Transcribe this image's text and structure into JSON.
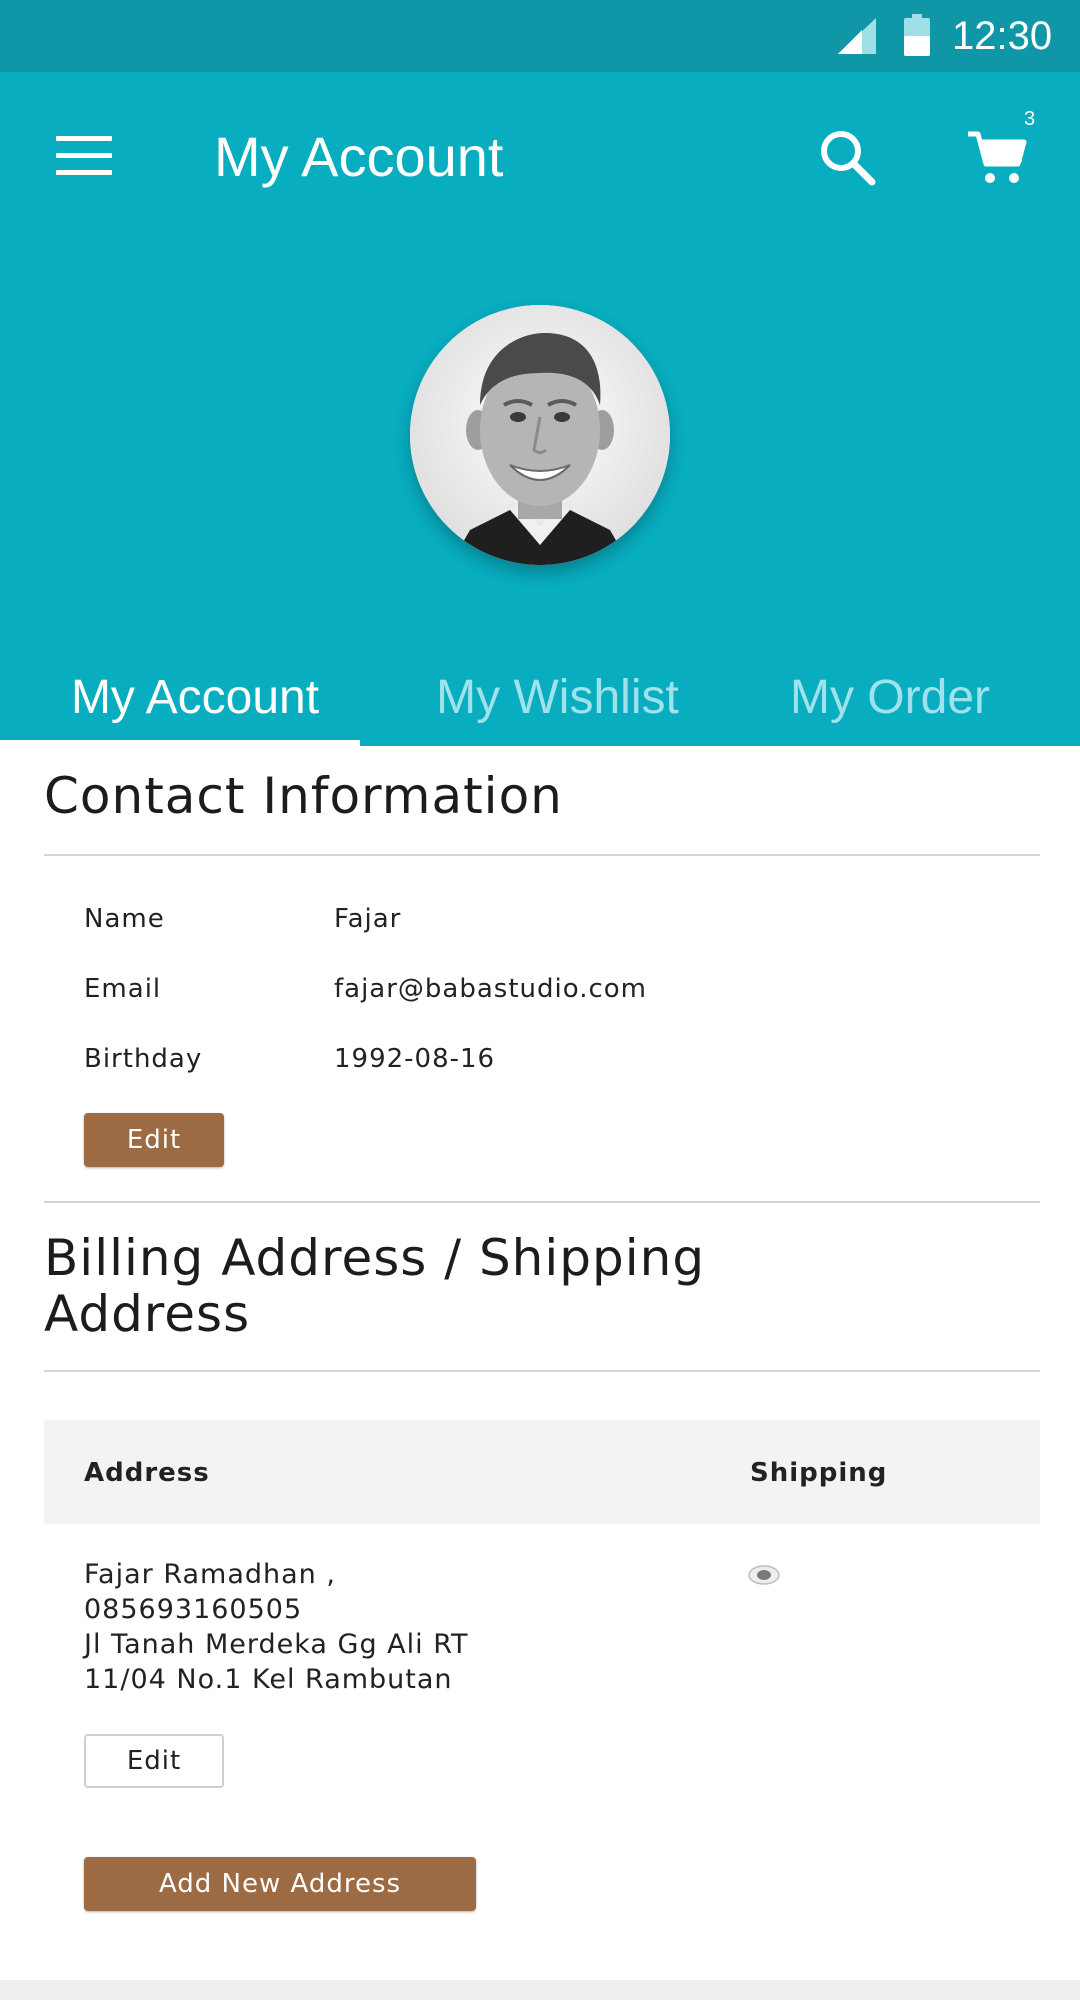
{
  "status_bar": {
    "time": "12:30"
  },
  "app_bar": {
    "title": "My Account",
    "cart_count": "3"
  },
  "tabs": [
    {
      "label": "My Account",
      "active": true
    },
    {
      "label": "My Wishlist",
      "active": false
    },
    {
      "label": "My Order",
      "active": false
    }
  ],
  "contact": {
    "title": "Contact Information",
    "fields": [
      {
        "label": "Name",
        "value": "Fajar"
      },
      {
        "label": "Email",
        "value": "fajar@babastudio.com"
      },
      {
        "label": "Birthday",
        "value": "1992-08-16"
      }
    ],
    "edit_label": "Edit"
  },
  "address": {
    "title_line1": "Billing Address / Shipping",
    "title_line2": "Address",
    "col_address": "Address",
    "col_shipping": "Shipping",
    "lines": [
      "Fajar Ramadhan ,",
      "085693160505",
      "Jl Tanah Merdeka Gg Ali RT",
      "11/04 No.1 Kel Rambutan"
    ],
    "edit_label": "Edit",
    "add_label": "Add New Address"
  },
  "colors": {
    "header": "#08adc0",
    "status_bar": "#0f97a7",
    "button_brown": "#9d6b43",
    "tab_inactive": "#9fe2ec"
  }
}
